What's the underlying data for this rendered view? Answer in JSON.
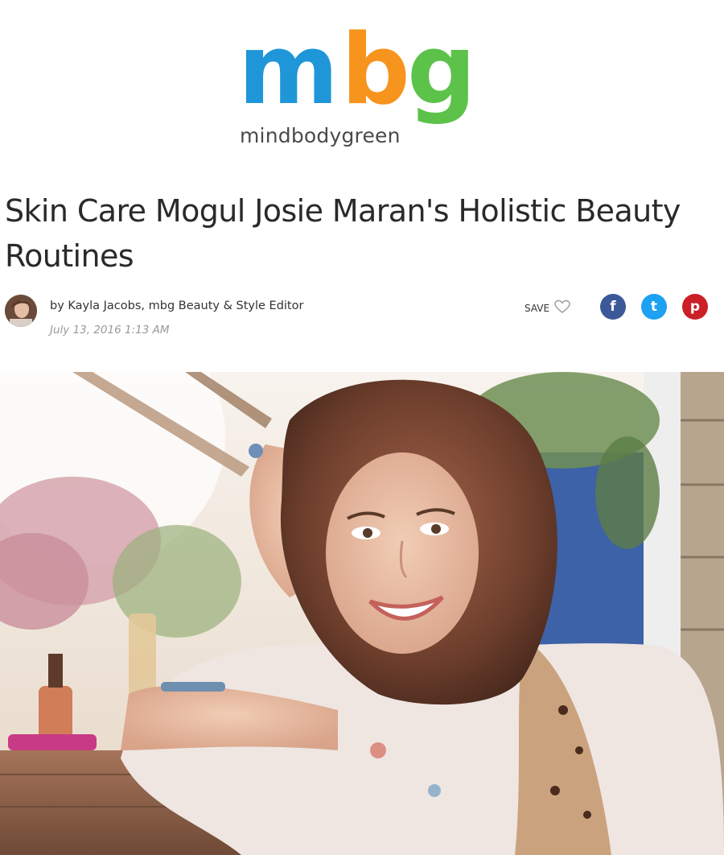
{
  "logo": {
    "letter_m": "m",
    "letter_b": "b",
    "letter_g": "g",
    "wordmark": "mindbodygreen",
    "colors": {
      "m": "#1f96d8",
      "b": "#f7941d",
      "g": "#5cc24a"
    }
  },
  "article": {
    "title": "Skin Care Mogul Josie Maran's Holistic Beauty Routines",
    "byline": "by Kayla Jacobs, mbg Beauty & Style Editor",
    "date": "July 13, 2016 1:13 AM"
  },
  "actions": {
    "save_label": "SAVE",
    "save_icon": "heart-outline-icon",
    "share": [
      {
        "network": "facebook",
        "glyph": "f",
        "icon": "facebook-icon",
        "color": "#3b5998"
      },
      {
        "network": "twitter",
        "glyph": "t",
        "icon": "twitter-icon",
        "color": "#1da1f2"
      },
      {
        "network": "pinterest",
        "glyph": "p",
        "icon": "pinterest-icon",
        "color": "#cb2027"
      }
    ]
  },
  "hero": {
    "subject": "hero-photo"
  }
}
